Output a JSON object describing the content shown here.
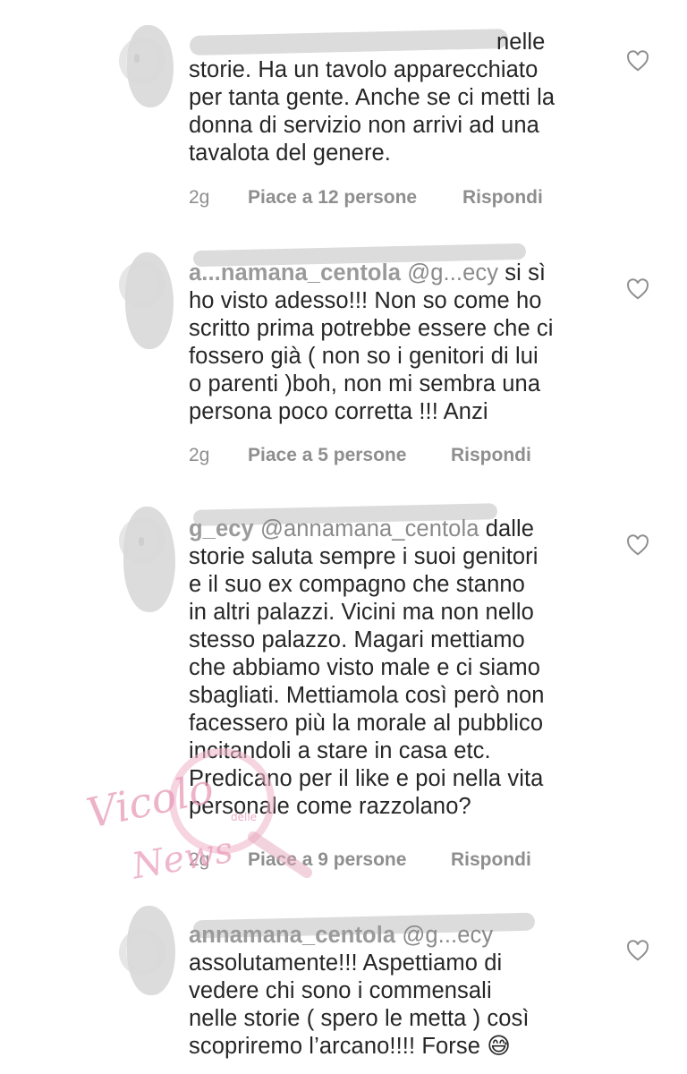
{
  "comments": [
    {
      "username": "",
      "mention": "",
      "lines": [
        "nelle",
        "storie. Ha un tavolo apparecchiato",
        "per tanta gente. Anche se ci metti la",
        "donna di servizio non arrivi ad una",
        "tavalota del genere."
      ],
      "time": "2g",
      "likes": "Piace a 12 persone",
      "reply": "Rispondi"
    },
    {
      "username": "a...namana_centola",
      "mention": "@g...ecy",
      "lines": [
        "si sì",
        "ho visto adesso!!! Non so come ho",
        "scritto prima potrebbe essere che ci",
        "fossero già ( non so i genitori di lui",
        "o parenti )boh, non mi sembra una",
        "persona poco corretta !!! Anzi"
      ],
      "time": "2g",
      "likes": "Piace a 5 persone",
      "reply": "Rispondi"
    },
    {
      "username": "g_ecy",
      "mention": "@annamana_centola",
      "lines": [
        "dalle",
        "storie saluta sempre i suoi genitori",
        "e il suo ex compagno che stanno",
        "in altri palazzi. Vicini ma non nello",
        "stesso palazzo. Magari mettiamo",
        "che abbiamo visto male e ci siamo",
        "sbagliati. Mettiamola così però non",
        "facessero più la morale al pubblico",
        "incitandoli a stare in casa etc.",
        "Predicano per il like e poi nella vita",
        "personale come razzolano?"
      ],
      "time": "2g",
      "likes": "Piace a 9 persone",
      "reply": "Rispondi"
    },
    {
      "username": "annamana_centola",
      "mention": "@g...ecy",
      "lines": [
        "assolutamente!!! Aspettiamo di",
        "vedere chi sono i commensali",
        "nelle storie ( spero le metta ) così",
        "scopriremo l’arcano!!!! Forse 😅"
      ],
      "time": "",
      "likes": "",
      "reply": ""
    }
  ],
  "watermark": {
    "line1": "Vicolo",
    "line2": "delle",
    "line3": "News"
  },
  "colors": {
    "text": "#262626",
    "meta": "#8e8e8e",
    "scribble": "#dcdcdc",
    "watermark": "#e89ab8"
  },
  "icons": {
    "like": "heart-outline-icon"
  }
}
